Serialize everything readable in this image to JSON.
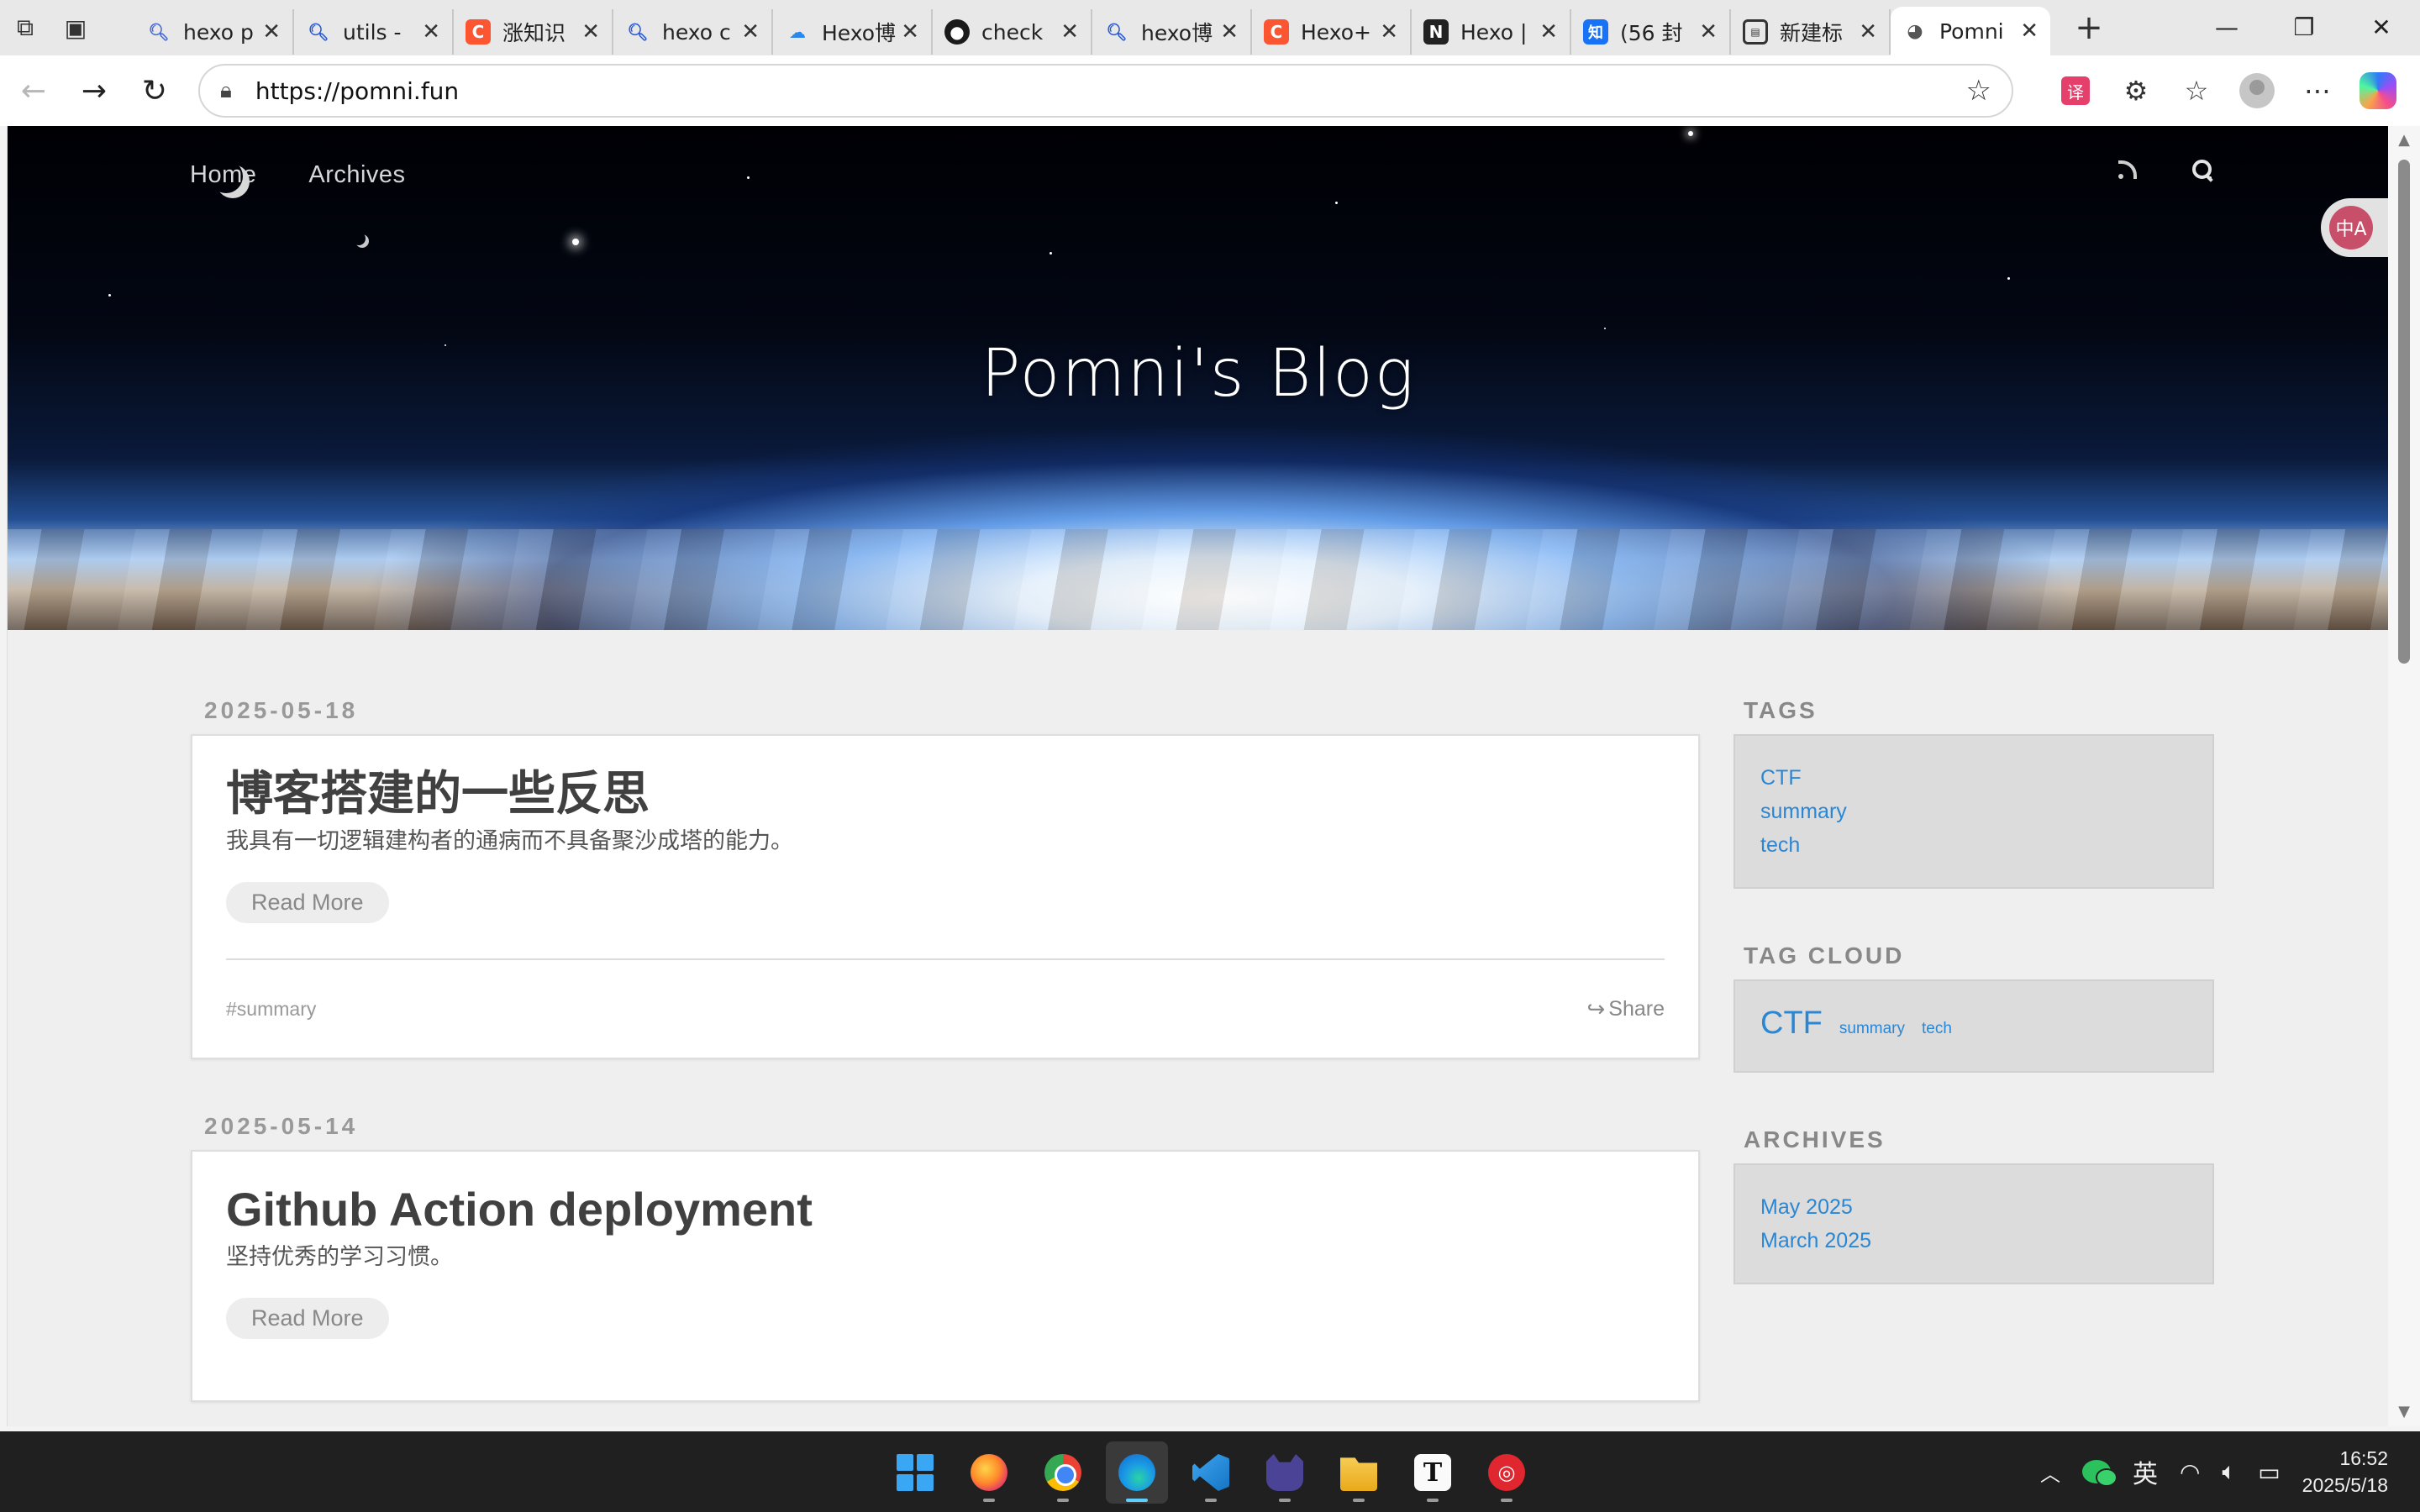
{
  "browser": {
    "tabs": [
      {
        "title": "hexo p",
        "favicon": "search-icon",
        "color": "#4a6bd6"
      },
      {
        "title": "utils -",
        "favicon": "search-icon",
        "color": "#2a5bd7"
      },
      {
        "title": "涨知识",
        "favicon": "csdn-icon",
        "color": "#fc5531"
      },
      {
        "title": "hexo c",
        "favicon": "search-icon",
        "color": "#2a5bd7"
      },
      {
        "title": "Hexo博",
        "favicon": "cloud-icon",
        "color": "#2a88e8"
      },
      {
        "title": "check",
        "favicon": "github-icon",
        "color": "#1a1a1a"
      },
      {
        "title": "hexo博",
        "favicon": "search-icon",
        "color": "#2a5bd7"
      },
      {
        "title": "Hexo+",
        "favicon": "csdn-icon",
        "color": "#fc5531"
      },
      {
        "title": "Hexo |",
        "favicon": "notion-icon",
        "color": "#222222"
      },
      {
        "title": "(56 封",
        "favicon": "zhihu-icon",
        "color": "#1772f6"
      },
      {
        "title": "新建标",
        "favicon": "newtab-icon",
        "color": "#333333"
      },
      {
        "title": "Pomni",
        "favicon": "pomni-icon",
        "color": "#555555"
      }
    ],
    "url": "https://pomni.fun"
  },
  "site": {
    "nav": [
      "Home",
      "Archives"
    ],
    "title": "Pomni's Blog",
    "translate_label": "中A"
  },
  "posts": [
    {
      "date": "2025-05-18",
      "title": "博客搭建的一些反思",
      "excerpt": "我具有一切逻辑建构者的通病而不具备聚沙成塔的能力。",
      "read_more": "Read More",
      "tag": "#summary",
      "share": "Share"
    },
    {
      "date": "2025-05-14",
      "title": "Github Action deployment",
      "excerpt": "坚持优秀的学习习惯。",
      "read_more": "Read More"
    }
  ],
  "sidebar": {
    "tags_title": "TAGS",
    "tags": [
      "CTF",
      "summary",
      "tech"
    ],
    "tagcloud_title": "TAG CLOUD",
    "tagcloud": [
      "CTF",
      "summary",
      "tech"
    ],
    "archives_title": "ARCHIVES",
    "archives": [
      "May 2025",
      "March 2025"
    ]
  },
  "taskbar": {
    "apps": [
      "start-menu",
      "firefox",
      "chrome",
      "edge",
      "vscode",
      "cat-app",
      "file-explorer",
      "typora",
      "netease-music"
    ],
    "active_app": "edge",
    "ime": "英",
    "time": "16:52",
    "date": "2025/5/18"
  }
}
